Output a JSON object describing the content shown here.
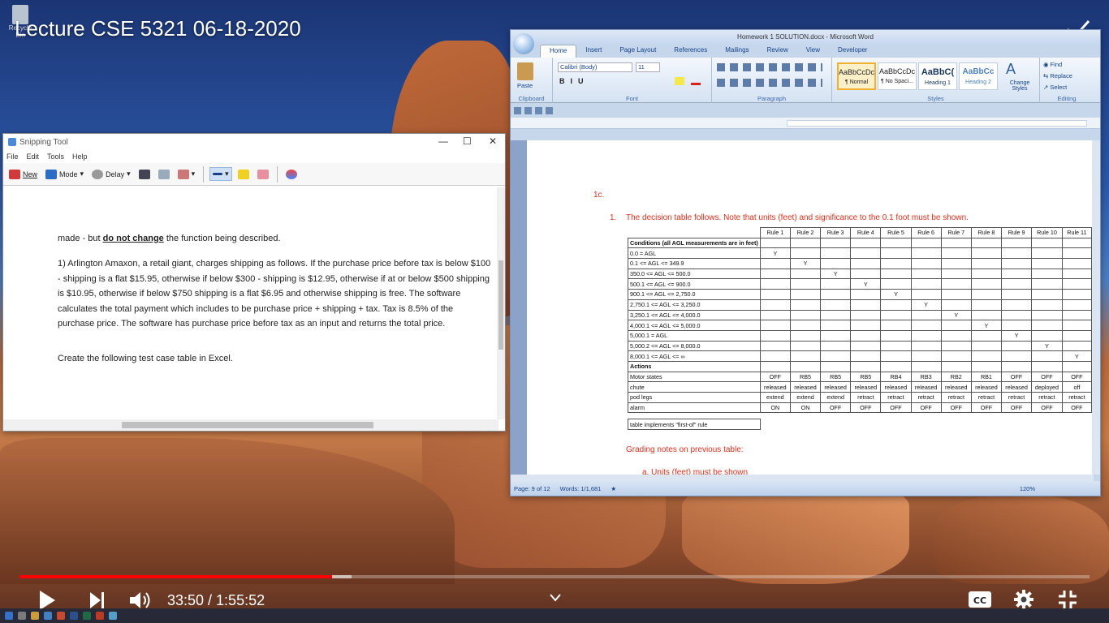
{
  "video": {
    "title": "Lecture CSE 5321 06-18-2020",
    "time": "33:50 / 1:55:52",
    "progress_fraction": 0.292,
    "buffered_fraction": 0.31,
    "accent": "#ff0000"
  },
  "desktop": {
    "recycle_label": "Recycle Bin"
  },
  "snip": {
    "title": "Snipping Tool",
    "menu": [
      "File",
      "Edit",
      "Tools",
      "Help"
    ],
    "toolbar": {
      "new": "New",
      "mode": "Mode",
      "delay": "Delay"
    },
    "content": {
      "line0a": "made - but ",
      "line0b": "do not change",
      "line0c": " the function being described.",
      "para1": "1)  Arlington Amaxon, a retail giant, charges shipping as follows. If the purchase price before tax is below $100 - shipping is a flat $15.95, otherwise if below $300 - shipping is $12.95, otherwise if at or below $500 shipping is $10.95, otherwise if below $750 shipping is a flat $6.95 and otherwise shipping is free. The software calculates the total payment which includes to be purchase price + shipping + tax. Tax is 8.5% of the purchase price. The software has purchase price before tax as an input and returns the total price.",
      "para2": "Create the following test case table in Excel."
    }
  },
  "word": {
    "title": "Homework 1 SOLUTION.docx - Microsoft Word",
    "tabs": [
      "Home",
      "Insert",
      "Page Layout",
      "References",
      "Mailings",
      "Review",
      "View",
      "Developer"
    ],
    "ribbon": {
      "paste": "Paste",
      "clipboard": "Clipboard",
      "font_name": "Calibri (Body)",
      "font_size": "11",
      "font": "Font",
      "paragraph": "Paragraph",
      "styles": "Styles",
      "editing": "Editing",
      "style_items": [
        {
          "preview": "AaBbCcDc",
          "name": "¶ Normal"
        },
        {
          "preview": "AaBbCcDc",
          "name": "¶ No Spaci..."
        },
        {
          "preview": "AaBbC(",
          "name": "Heading 1"
        },
        {
          "preview": "AaBbCc",
          "name": "Heading 2"
        }
      ],
      "change_styles": "Change Styles",
      "find": "Find",
      "replace": "Replace",
      "select": "Select"
    },
    "doc": {
      "section": "1c.",
      "item_num": "1.",
      "item_text": "The decision table follows. Note that units (feet) and significance to the 0.1 foot must be shown.",
      "grading": "Grading notes on previous table:",
      "cutoff": "a.    Units (feet) must be shown"
    },
    "table": {
      "rules": [
        "Rule 1",
        "Rule 2",
        "Rule 3",
        "Rule 4",
        "Rule 5",
        "Rule 6",
        "Rule 7",
        "Rule 8",
        "Rule 9",
        "Rule 10",
        "Rule 11"
      ],
      "conditions_header": "Conditions (all AGL measurements are in feet)",
      "conditions": [
        {
          "label": "0.0 = AGL",
          "mark": 0
        },
        {
          "label": "0.1 <= AGL <= 349.9",
          "mark": 1
        },
        {
          "label": "350.0 <= AGL <= 500.0",
          "mark": 2
        },
        {
          "label": "500.1 <= AGL <= 900.0",
          "mark": 3
        },
        {
          "label": "900.1 <= AGL <= 2,750.0",
          "mark": 4
        },
        {
          "label": "2,750.1 <= AGL <= 3,250.0",
          "mark": 5
        },
        {
          "label": "3,250.1 <= AGL <= 4,000.0",
          "mark": 6
        },
        {
          "label": "4,000.1 <= AGL <= 5,000.0",
          "mark": 7
        },
        {
          "label": "5,000.1 = AGL",
          "mark": 8
        },
        {
          "label": "5,000.2 <= AGL <= 8,000.0",
          "mark": 9
        },
        {
          "label": "8,000.1 <= AGL <= ∞",
          "mark": 10
        }
      ],
      "mark_char": "Y",
      "actions_header": "Actions",
      "actions": [
        {
          "label": "Motor states",
          "values": [
            "OFF",
            "RB5",
            "RB5",
            "RB5",
            "RB4",
            "RB3",
            "RB2",
            "RB1",
            "OFF",
            "OFF",
            "OFF"
          ]
        },
        {
          "label": "chute",
          "values": [
            "released",
            "released",
            "released",
            "released",
            "released",
            "released",
            "released",
            "released",
            "released",
            "deployed",
            "off"
          ]
        },
        {
          "label": "pod legs",
          "values": [
            "extend",
            "extend",
            "extend",
            "retract",
            "retract",
            "retract",
            "retract",
            "retract",
            "retract",
            "retract",
            "retract"
          ]
        },
        {
          "label": "alarm",
          "values": [
            "ON",
            "ON",
            "OFF",
            "OFF",
            "OFF",
            "OFF",
            "OFF",
            "OFF",
            "OFF",
            "OFF",
            "OFF"
          ]
        }
      ],
      "note": "table implements \"first-of\" rule"
    },
    "status": {
      "page": "Page: 9 of 12",
      "words": "Words: 1/1,681",
      "zoom": "120%"
    }
  }
}
